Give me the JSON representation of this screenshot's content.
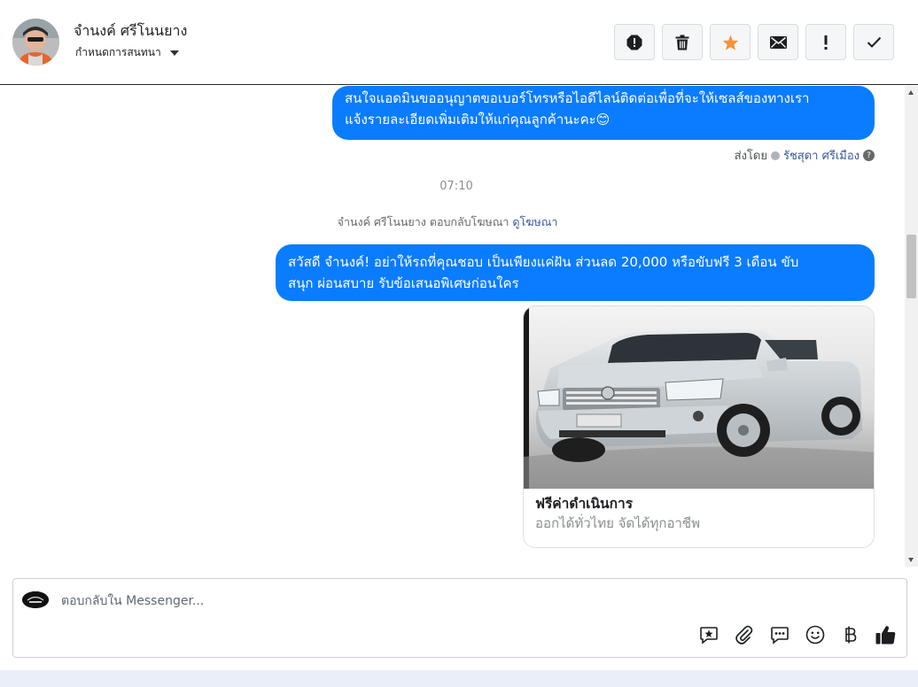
{
  "header": {
    "contact_name": "จำนงค์ ศรีโนนยาง",
    "convo_setting": "กำหนดการสนทนา"
  },
  "actions": [
    {
      "icon": "alert-octagon-icon"
    },
    {
      "icon": "trash-icon"
    },
    {
      "icon": "star-icon",
      "color": "#f7923b"
    },
    {
      "icon": "envelope-icon"
    },
    {
      "icon": "exclamation-icon"
    },
    {
      "icon": "checkmark-icon"
    }
  ],
  "thread": {
    "message1": {
      "line1": "สนใจแอดมินขออนุญาตขอเบอร์โทรหรือไอดีไลน์ติดต่อเพื่อที่จะให้เซลส์ของทางเรา",
      "line2": "แจ้งรายละเอียดเพิ่มเติมให้แก่คุณลูกค้านะคะ😊"
    },
    "sent_by_label": "ส่งโดย",
    "sent_by_name": "รัชสุดา ศรีเมือง",
    "help_icon": "?",
    "timestamp": "07:10",
    "ad_reply_text": "จำนงค์ ศรีโนนยาง ตอบกลับโฆษณา",
    "ad_reply_link": "ดูโฆษณา",
    "message2": {
      "line1": "สวัสดี จำนงค์! อย่าให้รถที่คุณชอบ เป็นเพียงแค่ฝัน ส่วนลด 20,000 หรือขับฟรี 3 เดือน ขับ",
      "line2": "สนุก ผ่อนสบาย รับข้อเสนอพิเศษก่อนใคร"
    },
    "card": {
      "title": "ฟรีค่าดำเนินการ",
      "subtitle": "ออกได้ทั่วไทย จัดได้ทุกอาชีพ"
    }
  },
  "composer": {
    "placeholder": "ตอบกลับใน Messenger...",
    "tools": [
      "saved-reply-icon",
      "attachment-icon",
      "chat-bubble-icon",
      "emoji-icon",
      "baht-icon",
      "thumbs-up-icon"
    ]
  },
  "colors": {
    "bubble": "#0a7cff",
    "link": "#385898"
  }
}
